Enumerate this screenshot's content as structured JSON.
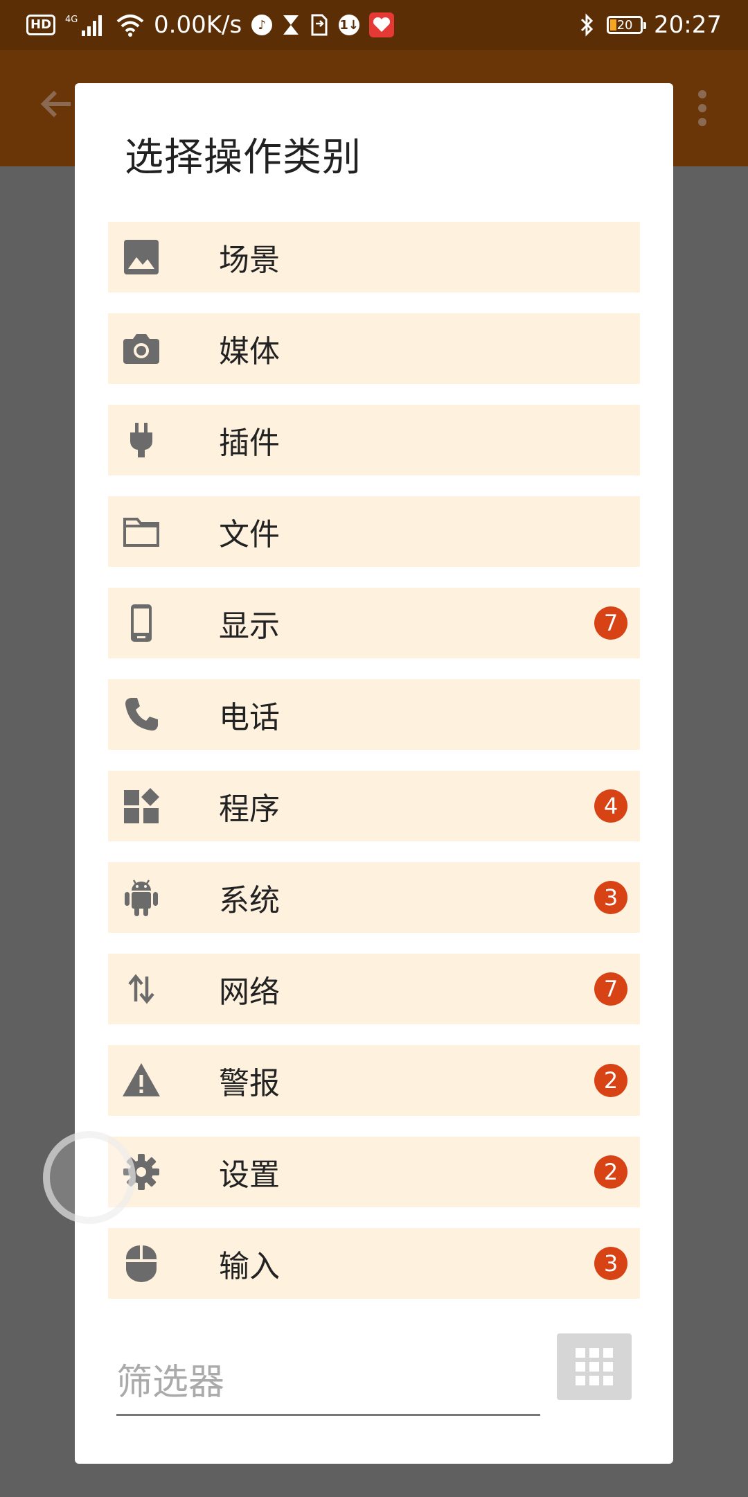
{
  "status_bar": {
    "hd": "HD",
    "net_type": "4G",
    "speed": "0.00K/s",
    "battery": "20",
    "time": "20:27"
  },
  "dialog": {
    "title": "选择操作类别",
    "items": [
      {
        "label": "场景",
        "icon": "image-icon",
        "badge": ""
      },
      {
        "label": "媒体",
        "icon": "camera-icon",
        "badge": ""
      },
      {
        "label": "插件",
        "icon": "plug-icon",
        "badge": ""
      },
      {
        "label": "文件",
        "icon": "folder-icon",
        "badge": ""
      },
      {
        "label": "显示",
        "icon": "phone-device-icon",
        "badge": "7"
      },
      {
        "label": "电话",
        "icon": "call-icon",
        "badge": ""
      },
      {
        "label": "程序",
        "icon": "apps-widgets-icon",
        "badge": "4"
      },
      {
        "label": "系统",
        "icon": "android-icon",
        "badge": "3"
      },
      {
        "label": "网络",
        "icon": "swap-vert-icon",
        "badge": "7"
      },
      {
        "label": "警报",
        "icon": "warning-icon",
        "badge": "2"
      },
      {
        "label": "设置",
        "icon": "gear-icon",
        "badge": "2"
      },
      {
        "label": "输入",
        "icon": "mouse-icon",
        "badge": "3"
      }
    ],
    "filter_placeholder": "筛选器"
  },
  "colors": {
    "status_bar": "#5b2e05",
    "app_bar": "#6a3607",
    "row_bg": "#fef1de",
    "icon": "#6b6b6b",
    "badge": "#d84315",
    "scrim": "#606060"
  }
}
